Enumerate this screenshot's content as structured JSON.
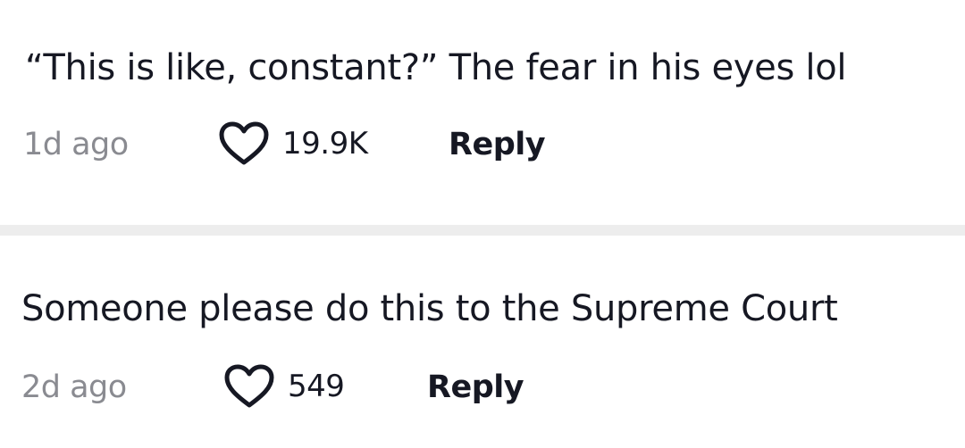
{
  "comments": [
    {
      "text": "“This is like, constant?” The fear in his eyes lol",
      "time": "1d ago",
      "likes": "19.9K",
      "reply_label": "Reply"
    },
    {
      "text": "Someone please do this to the Supreme Court",
      "time": "2d ago",
      "likes": "549",
      "reply_label": "Reply"
    }
  ],
  "icons": {
    "like": "heart-outline-icon"
  },
  "colors": {
    "text": "#161823",
    "secondary_text": "#8a8b91",
    "divider": "#ededed",
    "background": "#ffffff"
  }
}
